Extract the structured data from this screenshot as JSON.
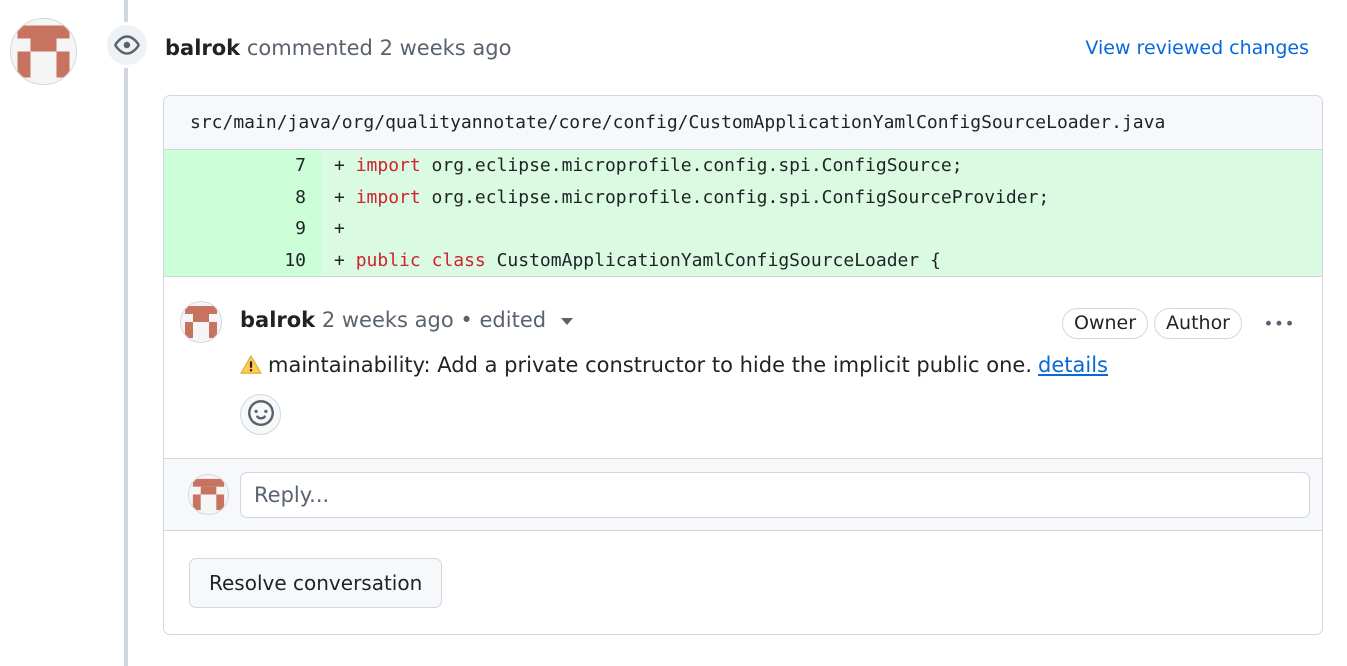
{
  "event": {
    "author": "balrok",
    "action": "commented",
    "time": "2 weeks ago",
    "view_changes_label": "View reviewed changes"
  },
  "file": {
    "path": "src/main/java/org/qualityannotate/core/config/CustomApplicationYamlConfigSourceLoader.java"
  },
  "diff": {
    "lines": [
      {
        "number": "7",
        "marker": "+",
        "parts": [
          {
            "text": "import",
            "kw": true
          },
          {
            "text": " org.eclipse.microprofile.config.spi.ConfigSource;",
            "kw": false
          }
        ]
      },
      {
        "number": "8",
        "marker": "+",
        "parts": [
          {
            "text": "import",
            "kw": true
          },
          {
            "text": " org.eclipse.microprofile.config.spi.ConfigSourceProvider;",
            "kw": false
          }
        ]
      },
      {
        "number": "9",
        "marker": "+",
        "parts": []
      },
      {
        "number": "10",
        "marker": "+",
        "parts": [
          {
            "text": "public",
            "kw": true
          },
          {
            "text": " ",
            "kw": false
          },
          {
            "text": "class",
            "kw": true
          },
          {
            "text": " CustomApplicationYamlConfigSourceLoader {",
            "kw": false
          }
        ]
      }
    ]
  },
  "comment": {
    "author": "balrok",
    "time": "2 weeks ago",
    "separator": "•",
    "edited_label": "edited",
    "badges": [
      "Owner",
      "Author"
    ],
    "body": "maintainability: Add a private constructor to hide the implicit public one.",
    "link_label": "details"
  },
  "reply": {
    "placeholder": "Reply..."
  },
  "resolve": {
    "label": "Resolve conversation"
  },
  "colors": {
    "link": "#0969da",
    "added_bg": "#dafbe1",
    "added_num_bg": "#ccffd8",
    "keyword": "#cf222e",
    "warning": "#d4a72c"
  },
  "icons": {
    "event": "eye-icon",
    "warning": "warning-icon",
    "emoji": "smiley-icon",
    "menu": "kebab-horizontal-icon"
  }
}
